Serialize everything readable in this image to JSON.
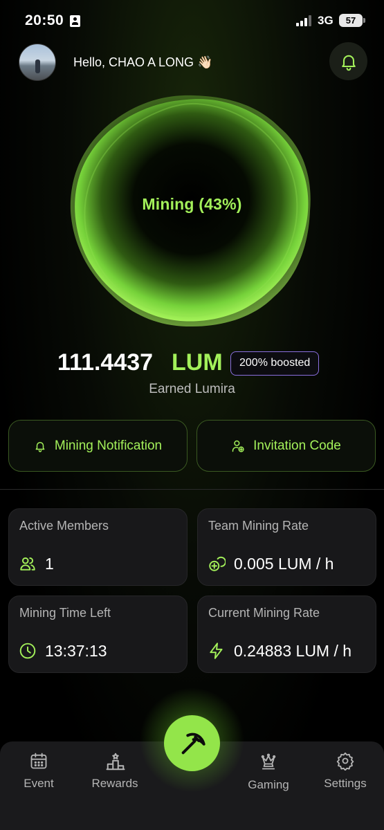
{
  "status_bar": {
    "time": "20:50",
    "network": "3G",
    "battery": "57",
    "icons": [
      "id-card-icon",
      "signal-bars-icon",
      "battery-icon"
    ]
  },
  "header": {
    "greeting": "Hello, CHAO A LONG 👋🏻",
    "avatar_icon": "user-avatar",
    "bell_icon": "bell-icon"
  },
  "orb": {
    "label": "Mining (43%)",
    "progress_percent": 43
  },
  "earnings": {
    "amount": "111.4437",
    "unit": "LUM",
    "boost_badge": "200% boosted",
    "caption": "Earned Lumira"
  },
  "actions": {
    "mining_notification": "Mining Notification",
    "invitation_code": "Invitation Code"
  },
  "stats": {
    "active_members": {
      "title": "Active Members",
      "value": "1",
      "icon": "users-icon"
    },
    "team_mining_rate": {
      "title": "Team Mining Rate",
      "value": "0.005 LUM / h",
      "icon": "coins-icon"
    },
    "mining_time_left": {
      "title": "Mining Time Left",
      "value": "13:37:13",
      "icon": "clock-icon"
    },
    "current_mining_rate": {
      "title": "Current Mining Rate",
      "value": "0.24883 LUM / h",
      "icon": "lightning-icon"
    }
  },
  "nav": {
    "event": "Event",
    "rewards": "Rewards",
    "gaming": "Gaming",
    "settings": "Settings",
    "mine_icon": "pickaxe-icon"
  },
  "colors": {
    "accent": "#a3f05a",
    "badge_border": "#8b6fe0",
    "card_bg": "#18181a",
    "nav_bg": "#1a1a1c"
  }
}
